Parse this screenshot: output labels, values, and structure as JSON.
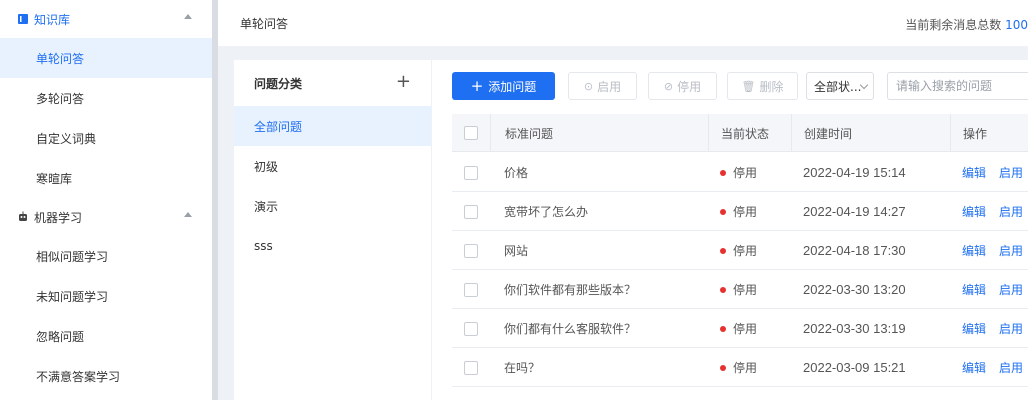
{
  "sidebar": {
    "groups": [
      {
        "title": "知识库",
        "icon": "book-icon",
        "items": [
          "单轮问答",
          "多轮问答",
          "自定义词典",
          "寒暄库"
        ]
      },
      {
        "title": "机器学习",
        "icon": "robot-icon",
        "items": [
          "相似问题学习",
          "未知问题学习",
          "忽略问题",
          "不满意答案学习"
        ]
      }
    ]
  },
  "topbar": {
    "title": "单轮问答",
    "remain_label": "当前剩余消息总数",
    "remain_value": "100"
  },
  "category": {
    "title": "问题分类",
    "add_label": "+",
    "items": [
      "全部问题",
      "初级",
      "演示",
      "sss"
    ]
  },
  "toolbar": {
    "add_label": "添加问题",
    "enable_label": "启用",
    "disable_label": "停用",
    "delete_label": "删除",
    "status_select": "全部状...",
    "search_placeholder": "请输入搜索的问题"
  },
  "table": {
    "headers": [
      "标准问题",
      "当前状态",
      "创建时间",
      "操作"
    ],
    "rows": [
      {
        "question": "价格",
        "status": "停用",
        "time": "2022-04-19 15:14",
        "edit": "编辑",
        "enable": "启用"
      },
      {
        "question": "宽带坏了怎么办",
        "status": "停用",
        "time": "2022-04-19 14:27",
        "edit": "编辑",
        "enable": "启用"
      },
      {
        "question": "网站",
        "status": "停用",
        "time": "2022-04-18 17:30",
        "edit": "编辑",
        "enable": "启用"
      },
      {
        "question": "你们软件都有那些版本？",
        "status": "停用",
        "time": "2022-03-30 13:20",
        "edit": "编辑",
        "enable": "启用"
      },
      {
        "question": "你们都有什么客服软件？",
        "status": "停用",
        "time": "2022-03-30 13:19",
        "edit": "编辑",
        "enable": "启用"
      },
      {
        "question": "在吗？",
        "status": "停用",
        "time": "2022-03-09 15:21",
        "edit": "编辑",
        "enable": "启用"
      }
    ]
  },
  "colors": {
    "accent": "#1e6ff1",
    "status_disabled": "#e5312f"
  }
}
